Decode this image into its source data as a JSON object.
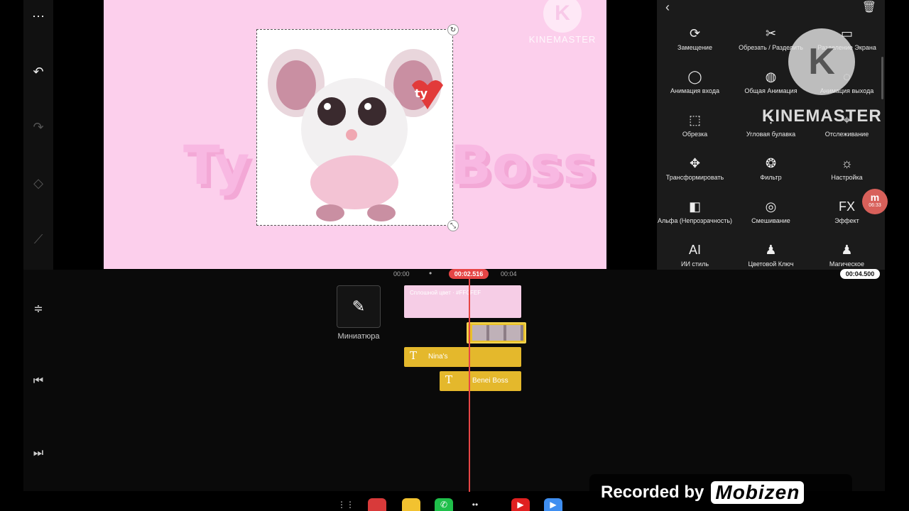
{
  "left_toolbar": {
    "icons": [
      "more-icon",
      "undo-icon",
      "redo-icon",
      "keyframe-icon",
      "graph-icon"
    ]
  },
  "preview": {
    "bg_title_left": "Ty",
    "bg_title_right": "Boss",
    "watermark_text": "KINEMASTER",
    "watermark_k": "K",
    "sticker_tag": "ty"
  },
  "panel": {
    "items": [
      {
        "label": "Замещение",
        "icon": "replace-icon",
        "glyph": "⟳"
      },
      {
        "label": "Обрезать / Разделить",
        "icon": "scissors-icon",
        "glyph": "✂"
      },
      {
        "label": "Разделение Экрана",
        "icon": "split-screen-icon",
        "glyph": "▭"
      },
      {
        "label": "Анимация входа",
        "icon": "in-animation-icon",
        "glyph": "◯"
      },
      {
        "label": "Общая Анимация",
        "icon": "overall-animation-icon",
        "glyph": "◍"
      },
      {
        "label": "Анимация выхода",
        "icon": "out-animation-icon",
        "glyph": "◌"
      },
      {
        "label": "Обрезка",
        "icon": "crop-icon",
        "glyph": "⬚"
      },
      {
        "label": "Угловая булавка",
        "icon": "corner-pin-icon",
        "glyph": "⁝"
      },
      {
        "label": "Отслеживание",
        "icon": "tracking-icon",
        "glyph": "⌖"
      },
      {
        "label": "Трансформировать",
        "icon": "transform-icon",
        "glyph": "✥"
      },
      {
        "label": "Фильтр",
        "icon": "filter-icon",
        "glyph": "❂"
      },
      {
        "label": "Настройка",
        "icon": "adjust-icon",
        "glyph": "☼"
      },
      {
        "label": "Альфа (Непрозрачность)",
        "icon": "alpha-icon",
        "glyph": "◧"
      },
      {
        "label": "Смешивание",
        "icon": "blend-icon",
        "glyph": "◎"
      },
      {
        "label": "Эффект",
        "icon": "effect-icon",
        "glyph": "FX"
      },
      {
        "label": "ИИ стиль",
        "icon": "ai-style-icon",
        "glyph": "AI"
      },
      {
        "label": "Цветовой Ключ",
        "icon": "chroma-key-icon",
        "glyph": "♟"
      },
      {
        "label": "Магическое",
        "icon": "magic-icon",
        "glyph": "♟"
      }
    ]
  },
  "overlay": {
    "kinemaster_logo": "K",
    "kinemaster_text": "KINEMASTER",
    "rec_badge_top": "m",
    "rec_badge_time": "06:33"
  },
  "timeline": {
    "ruler": [
      "00:00",
      "00:04"
    ],
    "playhead_time": "00:02.516",
    "duration": "00:04.500",
    "thumbnail_label": "Миниатюра",
    "clips": {
      "background": "Сплошной цвет · #FFCFEF",
      "text1": "Nina's",
      "text2": "Benei Boss"
    }
  },
  "recorder": {
    "by_text": "Recorded by",
    "brand": "Mobizen"
  }
}
